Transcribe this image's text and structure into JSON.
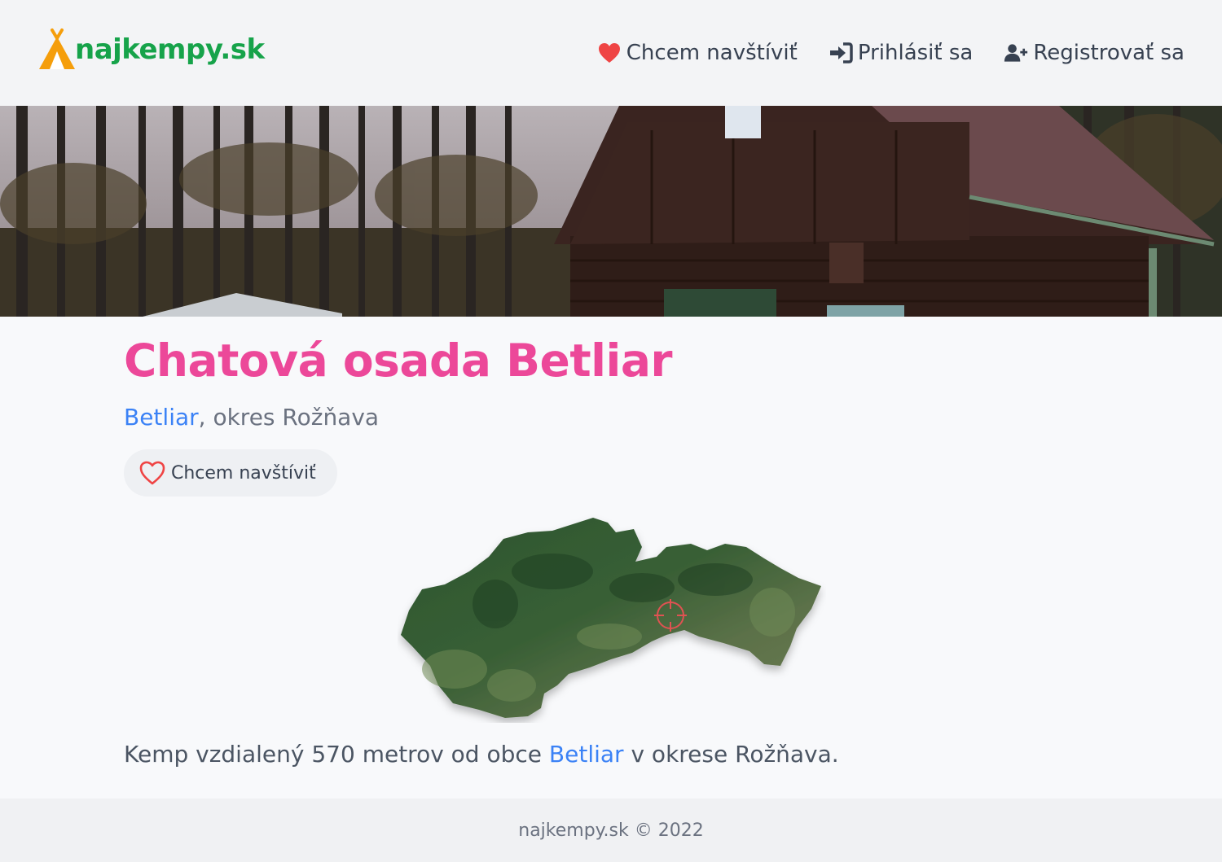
{
  "brand": {
    "name": "najkempy.sk",
    "color": "#16a34a",
    "icon_color": "#f59e0b"
  },
  "nav": [
    {
      "label": "Chcem navštíviť",
      "icon": "heart-icon"
    },
    {
      "label": "Prihlásiť sa",
      "icon": "sign-in-icon"
    },
    {
      "label": "Registrovať sa",
      "icon": "user-plus-icon"
    }
  ],
  "hero": {
    "image": "photo of dark wooden cabin among tall trees"
  },
  "camp": {
    "title": "Chatová osada Betliar",
    "village": "Betliar",
    "district_text": ", okres Rožňava",
    "visit_label": "Chcem navštíviť"
  },
  "map": {
    "marker": "crosshair-icon"
  },
  "description": {
    "prefix": "Kemp vzdialený 570 metrov od obce ",
    "village": "Betliar",
    "suffix": " v okrese Rožňava."
  },
  "footer": {
    "text": "najkempy.sk © 2022"
  },
  "colors": {
    "title": "#ec4899",
    "link": "#3b82f6",
    "heart": "#ef4444"
  }
}
